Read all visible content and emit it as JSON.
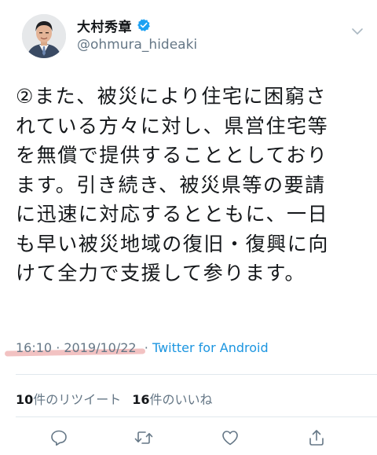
{
  "header": {
    "display_name": "大村秀章",
    "handle": "@ohmura_hideaki",
    "avatar_icon": "avatar-photo",
    "verified_icon": "verified-badge-icon",
    "menu_icon": "chevron-down-icon"
  },
  "tweet": {
    "text": "②また、被災により住宅に困窮さ\nれている方々に対し、県営住宅等\nを無償で提供することとしており\nます。引き続き、被災県等の要請\nに迅速に対応するとともに、一日\nも早い被災地域の復旧・復興に向\nけて全力で支援して参ります。"
  },
  "meta": {
    "timestamp": "16:10 · 2019/10/22",
    "separator": " · ",
    "source": "Twitter for Android"
  },
  "stats": {
    "retweet_count": "10",
    "retweet_label": "件のリツイート",
    "like_count": "16",
    "like_label": "件のいいね"
  },
  "actions": {
    "reply_icon": "reply-icon",
    "retweet_icon": "retweet-icon",
    "like_icon": "heart-icon",
    "share_icon": "share-icon"
  },
  "colors": {
    "text": "#14171a",
    "secondary": "#657786",
    "link": "#1b95e0",
    "verified": "#1da1f2",
    "divider": "#e1e8ed",
    "highlight": "#e27878"
  }
}
